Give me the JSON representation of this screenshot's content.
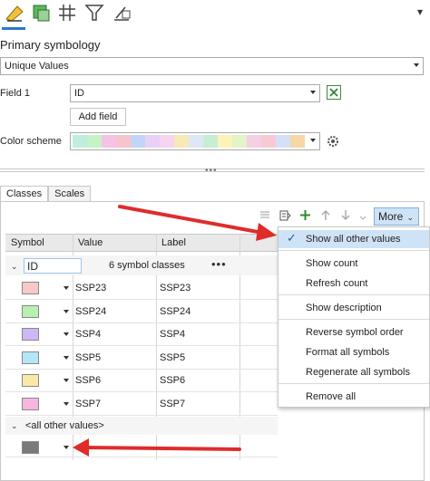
{
  "toolbar": {
    "icons": [
      "symbology-icon",
      "appearance-icon",
      "grid-icon",
      "filter-icon",
      "label-icon"
    ],
    "close_glyph": "▾"
  },
  "symbology": {
    "section_title": "Primary symbology",
    "method": "Unique Values",
    "field_label": "Field 1",
    "field_value": "ID",
    "add_field_label": "Add field",
    "color_scheme_label": "Color scheme",
    "scheme_colors": [
      "#bfeede",
      "#c6f3c6",
      "#f5c2e5",
      "#f7c3cf",
      "#c3d4f7",
      "#ead0f5",
      "#f7d4f0",
      "#f7e9b8",
      "#dde7f5",
      "#c7eed4",
      "#fbf3b8",
      "#e3f5c6",
      "#f5cfe5",
      "#f8c9d5",
      "#d5e0f7",
      "#f7d6a8"
    ]
  },
  "tabs": [
    {
      "label": "Classes",
      "active": true
    },
    {
      "label": "Scales",
      "active": false
    }
  ],
  "classes": {
    "more_label": "More",
    "columns": [
      "Symbol",
      "Value",
      "Label"
    ],
    "group_field": "ID",
    "group_count": "6 symbol classes",
    "group_menu": "•••",
    "rows": [
      {
        "value": "SSP23",
        "label": "SSP23",
        "color": "#f8c9c9"
      },
      {
        "value": "SSP24",
        "label": "SSP24",
        "color": "#b8f0b0"
      },
      {
        "value": "SSP4",
        "label": "SSP4",
        "color": "#cdb8f5"
      },
      {
        "value": "SSP5",
        "label": "SSP5",
        "color": "#b5e6f7"
      },
      {
        "value": "SSP6",
        "label": "SSP6",
        "color": "#fbe8a8"
      },
      {
        "value": "SSP7",
        "label": "SSP7",
        "color": "#f7b6de"
      }
    ],
    "other_values_label": "<all other values>",
    "other_symbol_color": "#7a7a7a"
  },
  "menu": {
    "items": [
      {
        "label": "Show all other values",
        "checked": true
      },
      {
        "label": "Show count",
        "checked": false
      },
      {
        "label": "Refresh count",
        "checked": false
      },
      {
        "label": "Show description",
        "checked": false
      },
      {
        "label": "Reverse symbol order",
        "checked": false
      },
      {
        "label": "Format all symbols",
        "checked": false
      },
      {
        "label": "Regenerate all symbols",
        "checked": false
      },
      {
        "label": "Remove all",
        "checked": false
      }
    ],
    "check_glyph": "✓"
  },
  "colors": {
    "accent": "#2b78d0",
    "annotation_arrow": "#e02b2b"
  }
}
